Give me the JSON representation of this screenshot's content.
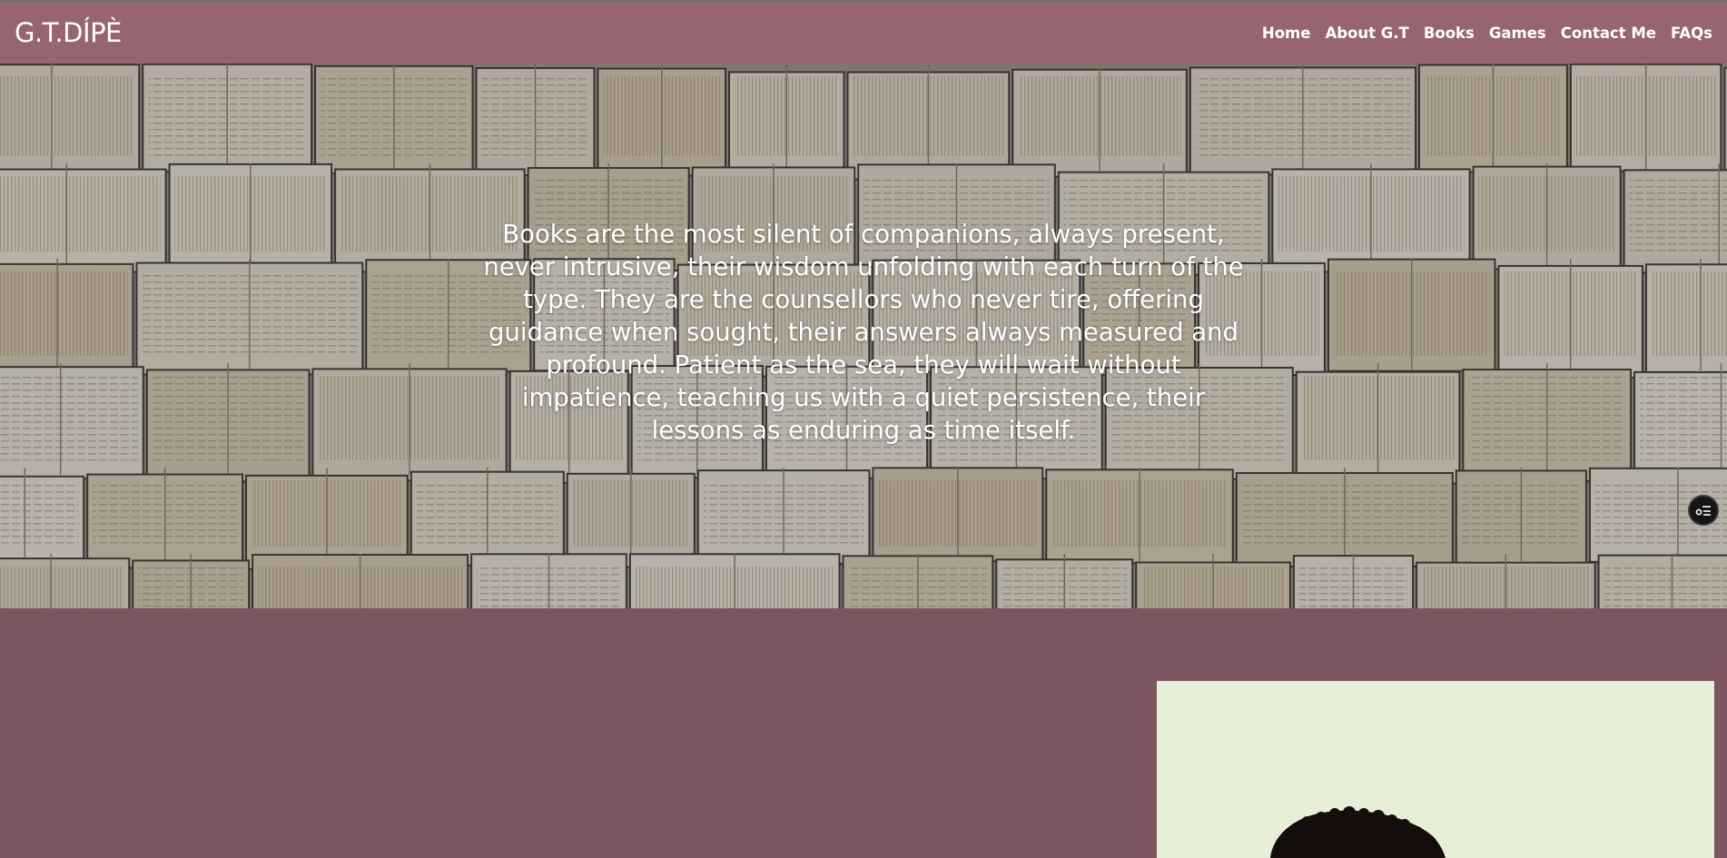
{
  "header": {
    "logo": "G.T.DÍPÈ",
    "nav": [
      {
        "label": "Home"
      },
      {
        "label": "About G.T"
      },
      {
        "label": "Books"
      },
      {
        "label": "Games"
      },
      {
        "label": "Contact Me"
      },
      {
        "label": "FAQs"
      }
    ]
  },
  "hero": {
    "quote": "Books are the most silent of companions, always present, never intrusive, their wisdom unfolding with each turn of the type. They are the counsellors who never tire, offering guidance when sought, their answers always measured and profound. Patient as the sea, they will wait without impatience, teaching us with a quiet persistence, their lessons as enduring as time itself.",
    "fab_icon": "list-settings-icon"
  },
  "colors": {
    "navbar": "#96656f",
    "page_background": "#7c5560",
    "portrait_background": "#e7efd9",
    "text": "#ffffff"
  }
}
